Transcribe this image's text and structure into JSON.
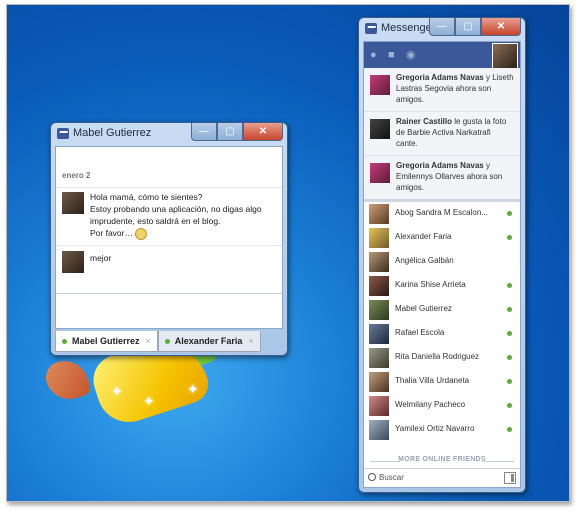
{
  "chat": {
    "title": "Mabel Gutierrez",
    "date": "enero 2",
    "messages": [
      {
        "lines": [
          "Hola mamá, cómo te sientes?",
          "Estoy probando una aplicación, no digas algo",
          "imprudente, esto saldrá en el blog.",
          "Por favor…"
        ]
      },
      {
        "lines": [
          "mejor"
        ]
      }
    ],
    "tabs": [
      {
        "label": "Mabel Gutierrez",
        "close": "×"
      },
      {
        "label": "Alexander Faria",
        "close": "×"
      }
    ],
    "controls": {
      "minimize": "—",
      "maximize": "▢",
      "close": "✕"
    }
  },
  "messenger": {
    "title": "Messenger",
    "controls": {
      "minimize": "—",
      "maximize": "▢",
      "close": "✕"
    },
    "feed": [
      {
        "bold": "Gregoria Adams Navas",
        "text": " y Liseth Lastras Segovia ahora son amigos."
      },
      {
        "bold": "Rainer Castillo",
        "text": " le gusta la foto de Barbie Activa Narkatrafi cante."
      },
      {
        "bold": "Gregoria Adams Navas",
        "text": " y Emilennys Ollarves ahora son amigos."
      }
    ],
    "friends": [
      "Abog Sandra M Escalon...",
      "Alexander Faria",
      "Angélica Galbán",
      "Karina Shise Arrieta",
      "Mabel Gutierrez",
      "Rafael Escola",
      "Rita Daniella Rodriguez",
      "Thalia Villa Urdaneta",
      "Welmilany Pacheco",
      "Yamilexi Ortiz Navarro"
    ],
    "more_label": "MORE ONLINE FRIENDS",
    "search_placeholder": "Buscar"
  },
  "colors": {
    "facebook_blue": "#3b5998",
    "online_green": "#5cad3c"
  }
}
